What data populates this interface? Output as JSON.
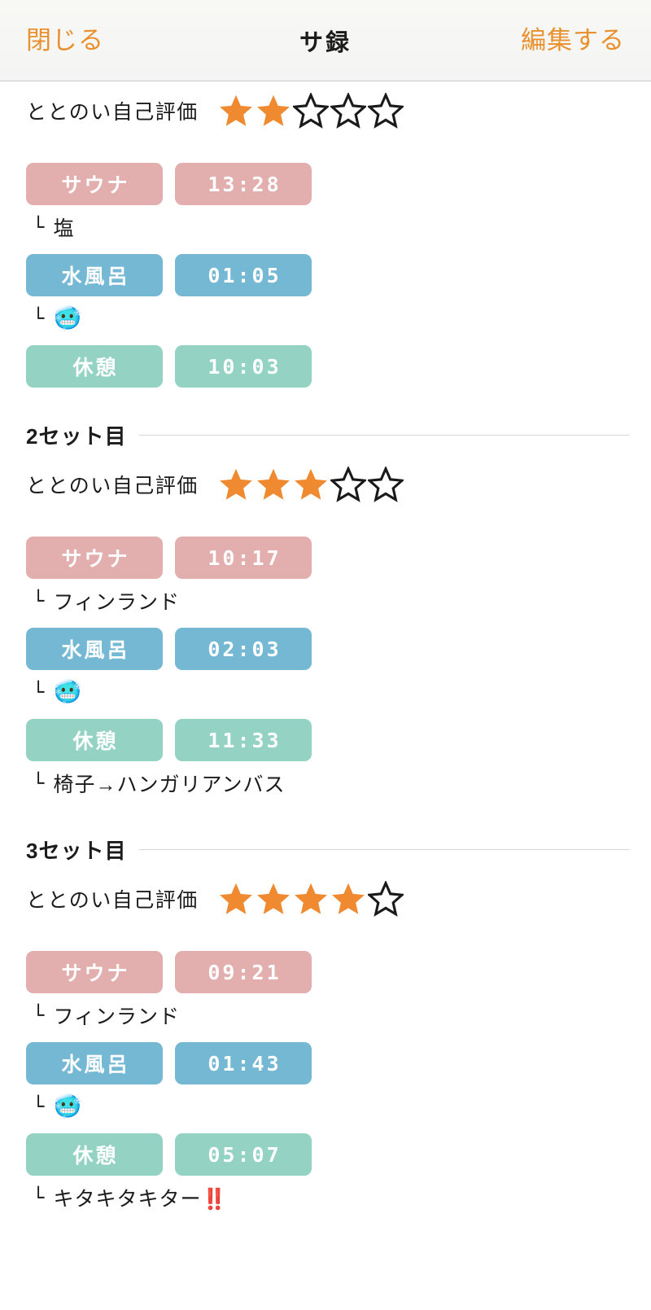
{
  "navbar": {
    "close_label": "閉じる",
    "title": "サ録",
    "edit_label": "編集する",
    "accent_color": "#e8912e"
  },
  "colors": {
    "sauna": "#e3aeae",
    "mizuburo": "#74b8d4",
    "kyukei": "#94d3c4",
    "star_filled": "#f08a30",
    "star_empty_outline": "#1a1a1a",
    "rule": "#d7d7d7"
  },
  "rating_label": "ととのい自己評価",
  "star_total": 5,
  "sets": [
    {
      "heading": "",
      "rating": 2,
      "steps": [
        {
          "label": "サウナ",
          "time": "13:28",
          "kind": "sauna",
          "note": "塩",
          "note_kind": "text"
        },
        {
          "label": "水風呂",
          "time": "01:05",
          "kind": "mizu",
          "note": "🥶",
          "note_kind": "emoji"
        },
        {
          "label": "休憩",
          "time": "10:03",
          "kind": "kyukei",
          "note": "",
          "note_kind": "none"
        }
      ]
    },
    {
      "heading": "2セット目",
      "rating": 3,
      "steps": [
        {
          "label": "サウナ",
          "time": "10:17",
          "kind": "sauna",
          "note": "フィンランド",
          "note_kind": "text"
        },
        {
          "label": "水風呂",
          "time": "02:03",
          "kind": "mizu",
          "note": "🥶",
          "note_kind": "emoji"
        },
        {
          "label": "休憩",
          "time": "11:33",
          "kind": "kyukei",
          "note": "椅子→ハンガリアンバス",
          "note_kind": "text"
        }
      ]
    },
    {
      "heading": "3セット目",
      "rating": 4,
      "steps": [
        {
          "label": "サウナ",
          "time": "09:21",
          "kind": "sauna",
          "note": "フィンランド",
          "note_kind": "text"
        },
        {
          "label": "水風呂",
          "time": "01:43",
          "kind": "mizu",
          "note": "🥶",
          "note_kind": "emoji"
        },
        {
          "label": "休憩",
          "time": "05:07",
          "kind": "kyukei",
          "note": "キタキタキター",
          "note_suffix": "‼️",
          "note_kind": "text"
        }
      ]
    }
  ]
}
